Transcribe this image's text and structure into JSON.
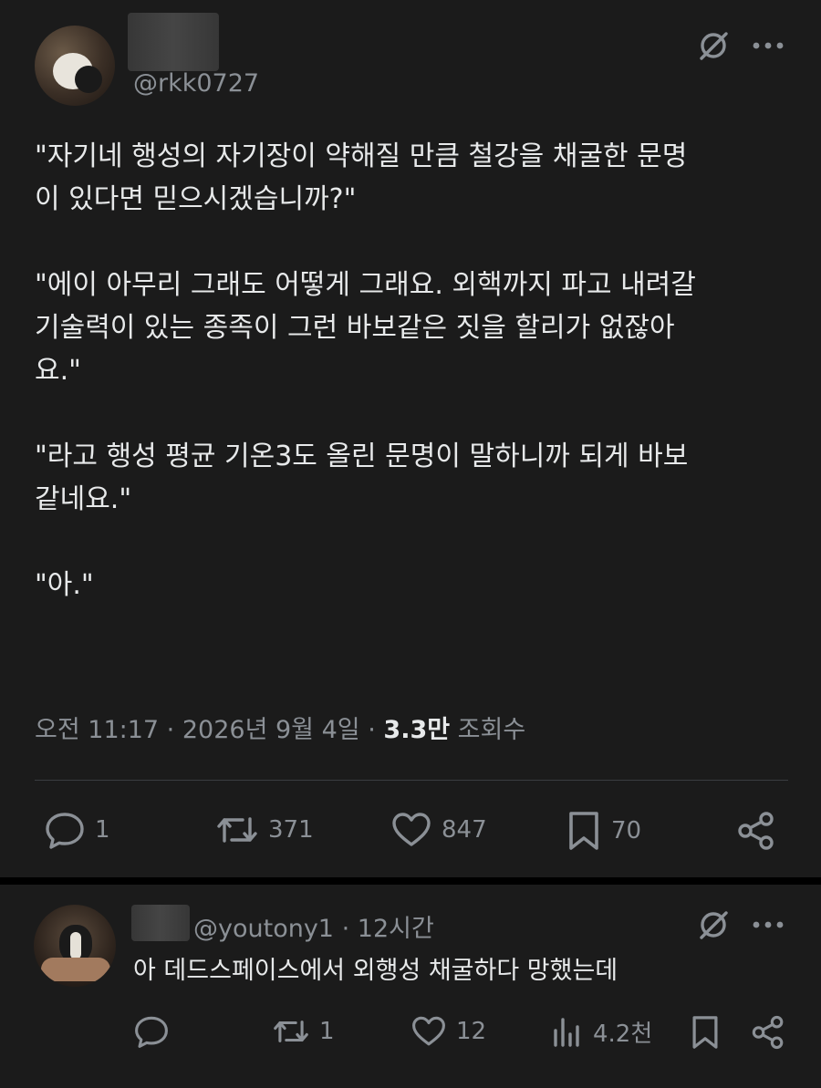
{
  "post": {
    "handle": "@rkk0727",
    "paragraphs": [
      "\"자기네 행성의 자기장이 약해질 만큼 철강을 채굴한 문명\n이 있다면 믿으시겠습니까?\"",
      "\"에이 아무리 그래도 어떻게 그래요. 외핵까지 파고 내려갈\n기술력이 있는 종족이 그런 바보같은 짓을 할리가 없잖아\n요.\"",
      "\"라고 행성 평균 기온3도 올린 문명이 말하니까 되게 바보\n같네요.\"",
      "\"아.\""
    ],
    "meta": {
      "time": "오전 11:17",
      "date": "2026년 9월 4일",
      "separator": "·",
      "views_count": "3.3만",
      "views_label": "조회수"
    },
    "actions": {
      "replies": "1",
      "reposts": "371",
      "likes": "847",
      "bookmarks": "70"
    }
  },
  "reply": {
    "handle": "@youtony1",
    "separator": "·",
    "time": "12시간",
    "text": "아 데드스페이스에서 외행성 채굴하다 망했는데",
    "actions": {
      "replies": "",
      "reposts": "1",
      "likes": "12",
      "views": "4.2천"
    }
  },
  "colors": {
    "background": "#1b1b1b",
    "text": "#e7e9ea",
    "muted": "#8b9096"
  }
}
